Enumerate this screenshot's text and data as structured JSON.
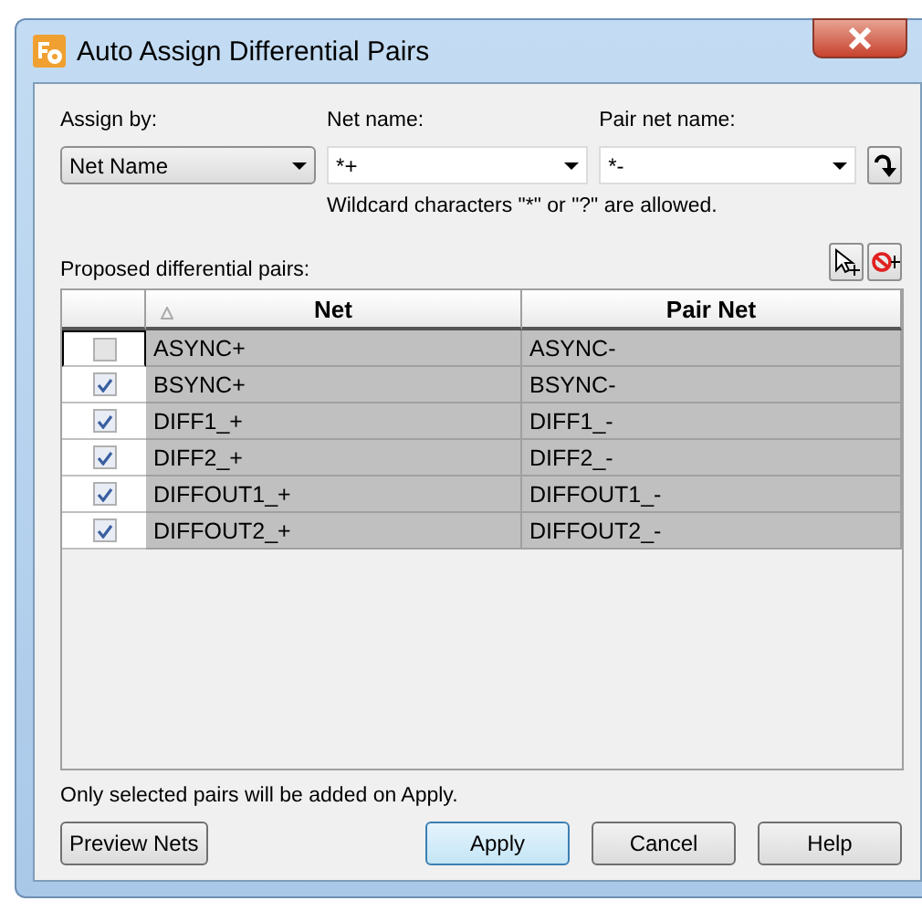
{
  "window": {
    "title": "Auto Assign Differential Pairs"
  },
  "assign_by": {
    "label": "Assign by:",
    "value": "Net Name"
  },
  "net_name": {
    "label": "Net name:",
    "value": "*+"
  },
  "pair_net_name": {
    "label": "Pair net name:",
    "value": "*-"
  },
  "hint": "Wildcard characters \"*\" or \"?\" are allowed.",
  "pairs_label": "Proposed differential pairs:",
  "table": {
    "columns": [
      "Net",
      "Pair Net"
    ],
    "rows": [
      {
        "net": "ASYNC+",
        "pair": "ASYNC-",
        "checked": false,
        "selected": true
      },
      {
        "net": "BSYNC+",
        "pair": "BSYNC-",
        "checked": true,
        "selected": true
      },
      {
        "net": "DIFF1_+",
        "pair": "DIFF1_-",
        "checked": true,
        "selected": true
      },
      {
        "net": "DIFF2_+",
        "pair": "DIFF2_-",
        "checked": true,
        "selected": true
      },
      {
        "net": "DIFFOUT1_+",
        "pair": "DIFFOUT1_-",
        "checked": true,
        "selected": true
      },
      {
        "net": "DIFFOUT2_+",
        "pair": "DIFFOUT2_-",
        "checked": true,
        "selected": true
      }
    ]
  },
  "note": "Only selected pairs will be added on Apply.",
  "buttons": [
    {
      "label": "Preview Nets",
      "kind": "preview"
    },
    {
      "label": "Apply",
      "kind": "default"
    },
    {
      "label": "Cancel",
      "kind": "normal"
    },
    {
      "label": "Help",
      "kind": "normal"
    }
  ]
}
